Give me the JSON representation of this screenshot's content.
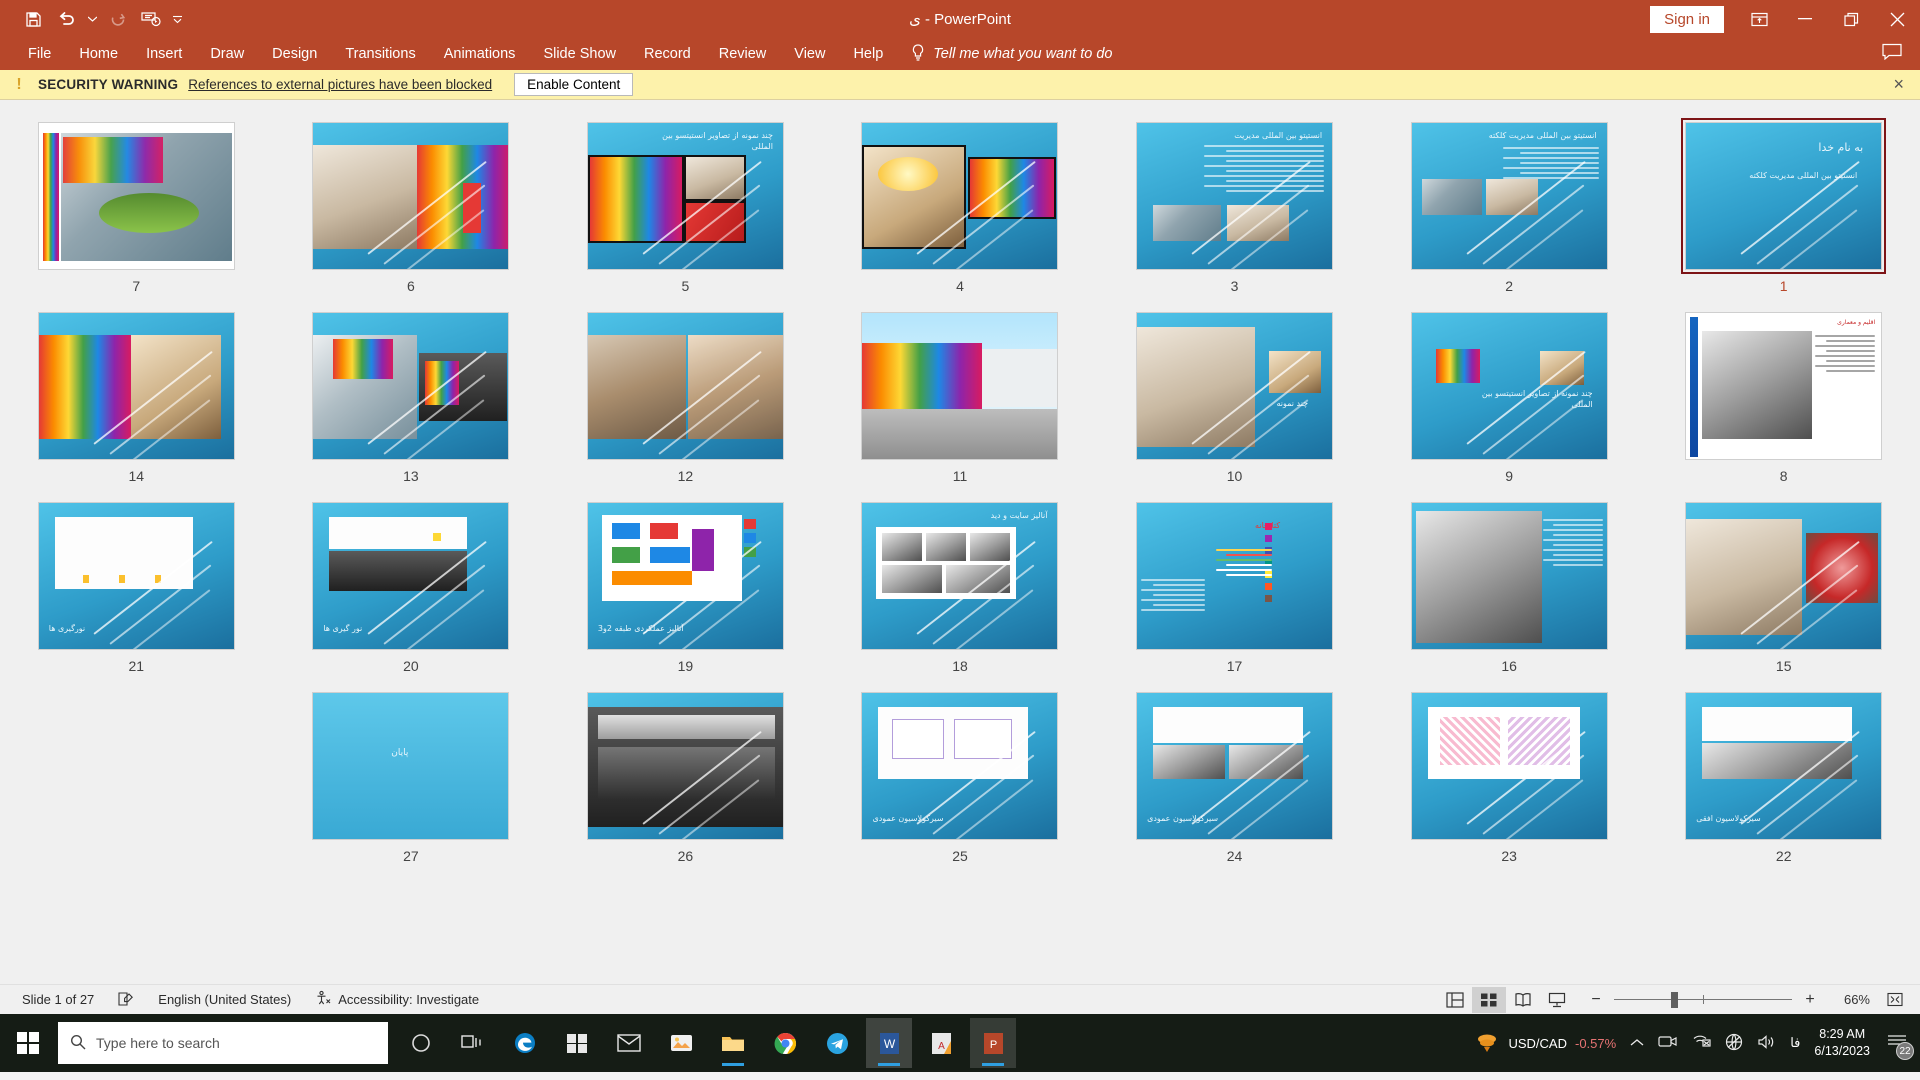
{
  "titlebar": {
    "document_title": "ی  -  PowerPoint",
    "signin_label": "Sign in",
    "qat": [
      {
        "name": "save-icon",
        "label": "Save"
      },
      {
        "name": "undo-icon",
        "label": "Undo"
      },
      {
        "name": "undo-dropdown-icon",
        "label": "Undo options"
      },
      {
        "name": "redo-icon",
        "label": "Redo"
      },
      {
        "name": "start-from-beginning-icon",
        "label": "Start From Beginning"
      },
      {
        "name": "customize-quick-access-toolbar-icon",
        "label": "Customize Quick Access Toolbar"
      }
    ],
    "window_controls": [
      {
        "name": "ribbon-display-options-icon",
        "label": "Ribbon Display Options"
      },
      {
        "name": "minimize-icon",
        "label": "Minimize"
      },
      {
        "name": "restore-icon",
        "label": "Restore Down"
      },
      {
        "name": "close-icon",
        "label": "Close"
      }
    ]
  },
  "ribbon": {
    "tabs": [
      "File",
      "Home",
      "Insert",
      "Draw",
      "Design",
      "Transitions",
      "Animations",
      "Slide Show",
      "Record",
      "Review",
      "View",
      "Help"
    ],
    "tellme": "Tell me what you want to do",
    "active_tab_index": -1
  },
  "security_warning": {
    "icon": "warning-icon",
    "label": "SECURITY WARNING",
    "message": "References to external pictures have been blocked",
    "button": "Enable Content",
    "close": "×",
    "background": "#fdf2ab"
  },
  "workspace": {
    "view": "Slide Sorter",
    "selected_slide": 1,
    "slides": [
      {
        "number": "7",
        "title": "",
        "style": "photo-arch-rainbow"
      },
      {
        "number": "6",
        "title": "",
        "style": "photo-interior-pair"
      },
      {
        "number": "5",
        "title": "چند نمونه از تصاویر انستیتسو بین المللی",
        "style": "photo-interior-pair-titled"
      },
      {
        "number": "4",
        "title": "",
        "style": "photo-interior-pair-frame"
      },
      {
        "number": "3",
        "title": "انستیتو بین المللی مدیریت",
        "style": "text-heavy"
      },
      {
        "number": "2",
        "title": "انستیتو بین المللی مدیریت کلکته",
        "style": "text-heavy-photo"
      },
      {
        "number": "1",
        "title": "به نام خدا",
        "subtitle": "انستیتو بین المللی مدیریت کلکته",
        "style": "title-slide"
      },
      {
        "number": "14",
        "title": "",
        "style": "photo-rainbow-interior"
      },
      {
        "number": "13",
        "title": "",
        "style": "photo-stairs-rainbow"
      },
      {
        "number": "12",
        "title": "",
        "style": "photo-people-two"
      },
      {
        "number": "11",
        "title": "",
        "style": "photo-facade"
      },
      {
        "number": "10",
        "title": "چند نمونه",
        "style": "photo-corridor"
      },
      {
        "number": "9",
        "title": "چند نمونه از تصاویر انستیتسو بین المللی",
        "style": "photo-two-small"
      },
      {
        "number": "8",
        "title": "اقلیم و معماری",
        "style": "white-text-diagram"
      },
      {
        "number": "21",
        "title": "نورگیری ها",
        "style": "plan-yellow"
      },
      {
        "number": "20",
        "title": "نور گیری ها",
        "style": "plan-dark"
      },
      {
        "number": "19",
        "title": "آنالیز عملکردی طبقه 2و3",
        "style": "diagram-blocks"
      },
      {
        "number": "18",
        "title": "آنالیز سایت و دید",
        "style": "diagram-photos"
      },
      {
        "number": "17",
        "title": "کتابخانه",
        "style": "legend-list"
      },
      {
        "number": "16",
        "title": "",
        "style": "aerial-gray"
      },
      {
        "number": "15",
        "title": "",
        "style": "photo-interior-red"
      },
      {
        "number": "27",
        "title": "پایان",
        "style": "end-slide"
      },
      {
        "number": "26",
        "title": "",
        "style": "photo-dark-wide"
      },
      {
        "number": "25",
        "title": "سیرکولاسیون عمودی",
        "style": "plan-white"
      },
      {
        "number": "24",
        "title": "سیرکولاسیون عمودی",
        "style": "plan-gray-photos"
      },
      {
        "number": "23",
        "title": "",
        "style": "plan-pink"
      },
      {
        "number": "22",
        "title": "سیرکولاسیون افقی",
        "style": "plan-mono"
      }
    ]
  },
  "statusbar": {
    "slide_counter": "Slide 1 of 27",
    "notes_icon": "notes-icon",
    "language": "English (United States)",
    "accessibility": "Accessibility: Investigate",
    "view_buttons": [
      {
        "name": "normal-view-button",
        "label": "Normal",
        "active": false
      },
      {
        "name": "slide-sorter-view-button",
        "label": "Slide Sorter",
        "active": true
      },
      {
        "name": "reading-view-button",
        "label": "Reading View",
        "active": false
      },
      {
        "name": "slide-show-button",
        "label": "Slide Show",
        "active": false
      }
    ],
    "zoom_out": "−",
    "zoom_in": "+",
    "zoom_value": "66%",
    "fit_button": "fit-slide-to-window-icon"
  },
  "taskbar": {
    "start": "windows-start-button",
    "search_placeholder": "Type here to search",
    "apps": [
      {
        "name": "cortana-icon",
        "label": "Cortana"
      },
      {
        "name": "task-view-icon",
        "label": "Task View"
      },
      {
        "name": "edge-icon",
        "label": "Microsoft Edge"
      },
      {
        "name": "microsoft-store-icon",
        "label": "Microsoft Store"
      },
      {
        "name": "mail-icon",
        "label": "Mail"
      },
      {
        "name": "photos-icon",
        "label": "Photos"
      },
      {
        "name": "file-explorer-icon",
        "label": "File Explorer"
      },
      {
        "name": "chrome-icon",
        "label": "Google Chrome"
      },
      {
        "name": "telegram-icon",
        "label": "Telegram"
      },
      {
        "name": "word-icon",
        "label": "Microsoft Word"
      },
      {
        "name": "acrobat-icon",
        "label": "Adobe Acrobat"
      },
      {
        "name": "powerpoint-icon",
        "label": "Microsoft PowerPoint"
      }
    ],
    "tray": {
      "weather_icon": "weather-icon",
      "stock_label": "USD/CAD",
      "stock_change": "-0.57%",
      "chevron": "show-hidden-icons",
      "icons": [
        "meet-now-icon",
        "network-icon",
        "globe-icon",
        "volume-icon"
      ],
      "language": "فا",
      "time": "8:29 AM",
      "date": "6/13/2023",
      "notification_count": "22"
    }
  },
  "colors": {
    "accent": "#b7472a",
    "warning_bg": "#fdf2ab",
    "selected_border": "#7d1416",
    "slide_blue": "#2e9cc9"
  }
}
